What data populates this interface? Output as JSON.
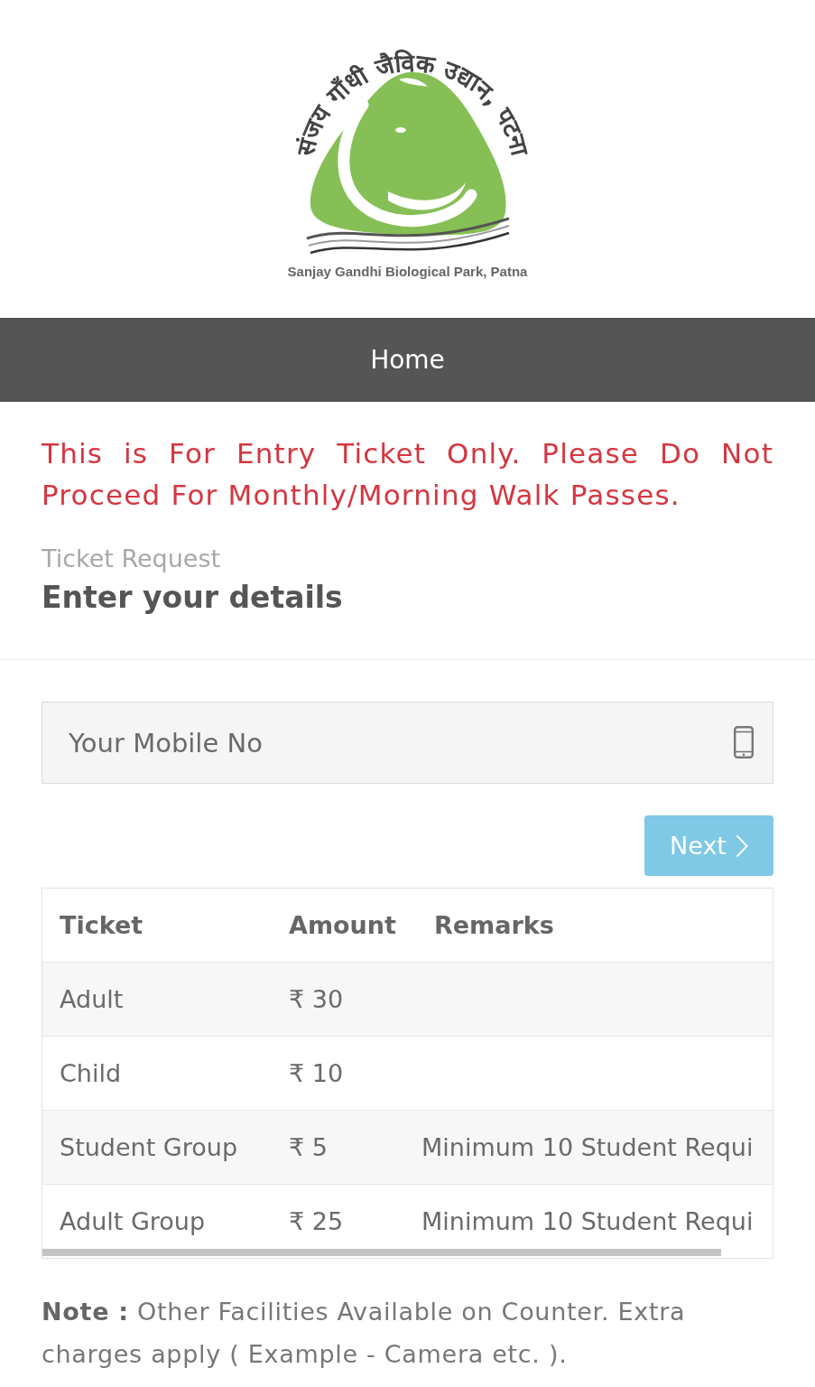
{
  "logo": {
    "arc_text": "संजय गाँधी जैविक उद्यान, पटना",
    "caption": "Sanjay Gandhi Biological Park, Patna"
  },
  "nav": {
    "items": [
      {
        "label": "Home"
      }
    ]
  },
  "notice": "This is For Entry Ticket Only. Please Do Not Proceed For Monthly/Morning Walk Passes.",
  "heading": {
    "label": "Ticket Request",
    "title": "Enter your details"
  },
  "form": {
    "mobile_field": {
      "placeholder": "Your Mobile No"
    },
    "next_button": {
      "label": "Next"
    }
  },
  "table": {
    "columns": [
      "Ticket",
      "Amount",
      "Remarks"
    ],
    "rows": [
      {
        "ticket": "Adult",
        "amount": "₹ 30"
      },
      {
        "ticket": "Child",
        "amount": "₹ 10"
      },
      {
        "ticket": "Student Group",
        "amount": "₹ 5",
        "remarks": "Minimum 10 Student Requi"
      },
      {
        "ticket": "Adult Group",
        "amount": "₹ 25",
        "remarks": "Minimum 10 Student Requi"
      }
    ]
  },
  "note": "**Note :** Other Facilities Available on Counter. Extra charges apply ( Example - Camera etc. )."
}
